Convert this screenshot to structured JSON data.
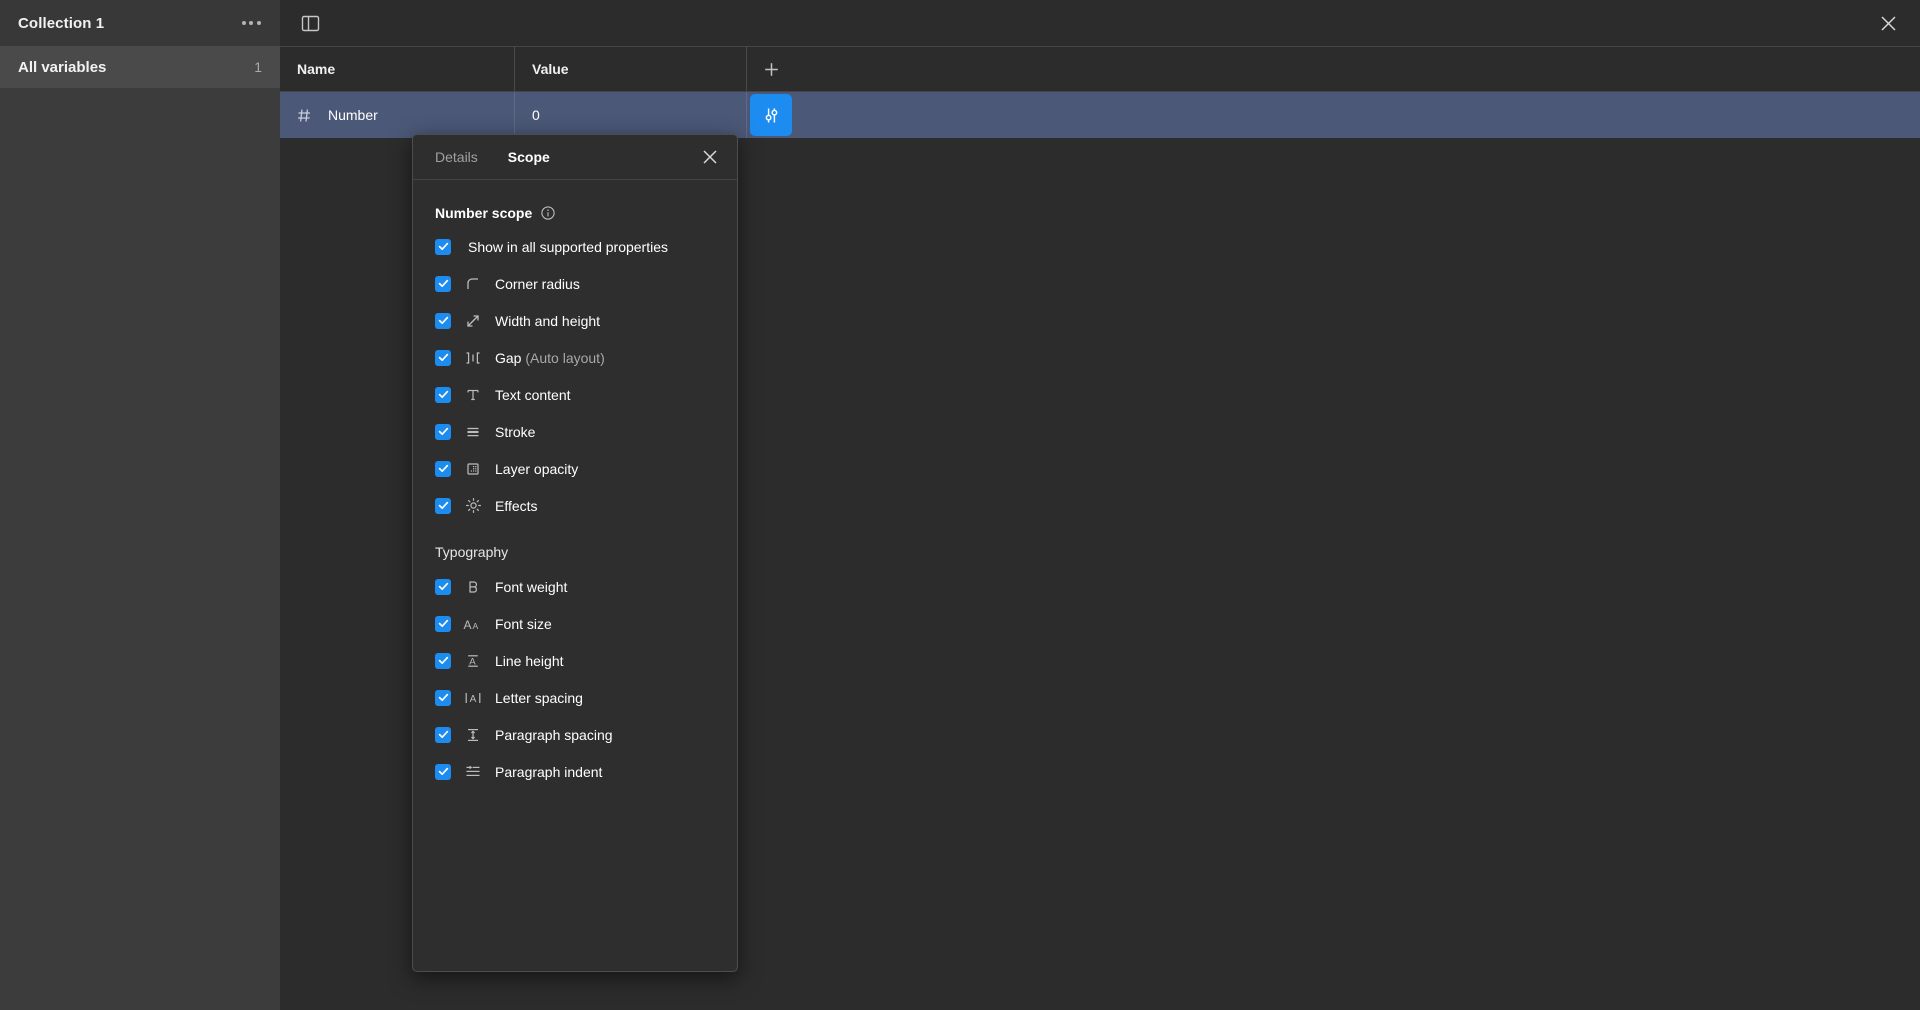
{
  "sidebar": {
    "title": "Collection 1",
    "more_icon": "ellipsis-icon",
    "items": [
      {
        "label": "All variables",
        "count": "1",
        "selected": true
      }
    ]
  },
  "topbar": {
    "panel_toggle_icon": "layout-panel-icon",
    "close_icon": "close-icon"
  },
  "table": {
    "columns": [
      {
        "key": "name",
        "label": "Name"
      },
      {
        "key": "value",
        "label": "Value"
      }
    ],
    "add_column_label": "+",
    "rows": [
      {
        "type_icon": "number-hash-icon",
        "name": "Number",
        "value": "0",
        "scope_button_icon": "sliders-icon",
        "selected": true
      }
    ]
  },
  "scope_panel": {
    "tabs": [
      {
        "label": "Details",
        "active": false
      },
      {
        "label": "Scope",
        "active": true
      }
    ],
    "close_icon": "close-icon",
    "section_title": "Number scope",
    "info_icon": "info-icon",
    "options": [
      {
        "label": "Show in all supported properties",
        "label_muted": "",
        "checked": true,
        "icon": null
      },
      {
        "label": "Corner radius",
        "label_muted": "",
        "checked": true,
        "icon": "corner-radius-icon"
      },
      {
        "label": "Width and height",
        "label_muted": "",
        "checked": true,
        "icon": "width-height-icon"
      },
      {
        "label": "Gap ",
        "label_muted": "(Auto layout)",
        "checked": true,
        "icon": "gap-icon"
      },
      {
        "label": "Text content",
        "label_muted": "",
        "checked": true,
        "icon": "text-content-icon"
      },
      {
        "label": "Stroke",
        "label_muted": "",
        "checked": true,
        "icon": "stroke-icon"
      },
      {
        "label": "Layer opacity",
        "label_muted": "",
        "checked": true,
        "icon": "layer-opacity-icon"
      },
      {
        "label": "Effects",
        "label_muted": "",
        "checked": true,
        "icon": "effects-icon"
      }
    ],
    "typography_title": "Typography",
    "typography_options": [
      {
        "label": "Font weight",
        "label_muted": "",
        "checked": true,
        "icon": "font-weight-icon"
      },
      {
        "label": "Font size",
        "label_muted": "",
        "checked": true,
        "icon": "font-size-icon"
      },
      {
        "label": "Line height",
        "label_muted": "",
        "checked": true,
        "icon": "line-height-icon"
      },
      {
        "label": "Letter spacing",
        "label_muted": "",
        "checked": true,
        "icon": "letter-spacing-icon"
      },
      {
        "label": "Paragraph spacing",
        "label_muted": "",
        "checked": true,
        "icon": "paragraph-spacing-icon"
      },
      {
        "label": "Paragraph indent",
        "label_muted": "",
        "checked": true,
        "icon": "paragraph-indent-icon"
      }
    ]
  },
  "colors": {
    "accent": "#1d8cf0",
    "row_selected": "#4b5877",
    "app_bg": "#2c2c2c",
    "sidebar_bg": "#3c3c3c",
    "panel_bg": "#2e2e2e"
  }
}
